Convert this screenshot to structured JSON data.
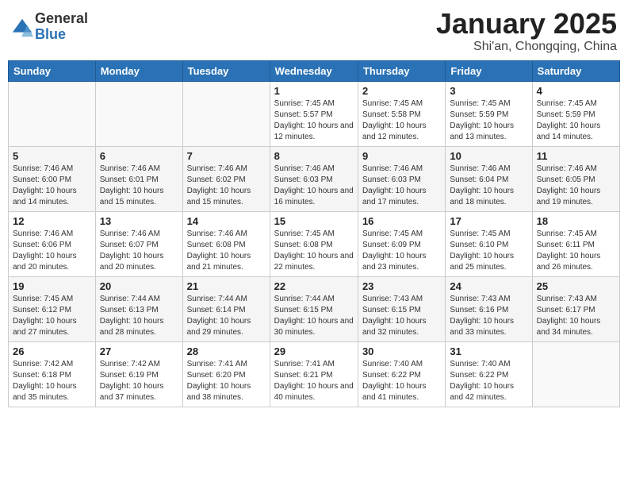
{
  "header": {
    "logo": {
      "general": "General",
      "blue": "Blue"
    },
    "title": "January 2025",
    "location": "Shi'an, Chongqing, China"
  },
  "calendar": {
    "weekdays": [
      "Sunday",
      "Monday",
      "Tuesday",
      "Wednesday",
      "Thursday",
      "Friday",
      "Saturday"
    ],
    "weeks": [
      [
        {
          "day": "",
          "info": ""
        },
        {
          "day": "",
          "info": ""
        },
        {
          "day": "",
          "info": ""
        },
        {
          "day": "1",
          "info": "Sunrise: 7:45 AM\nSunset: 5:57 PM\nDaylight: 10 hours and 12 minutes."
        },
        {
          "day": "2",
          "info": "Sunrise: 7:45 AM\nSunset: 5:58 PM\nDaylight: 10 hours and 12 minutes."
        },
        {
          "day": "3",
          "info": "Sunrise: 7:45 AM\nSunset: 5:59 PM\nDaylight: 10 hours and 13 minutes."
        },
        {
          "day": "4",
          "info": "Sunrise: 7:45 AM\nSunset: 5:59 PM\nDaylight: 10 hours and 14 minutes."
        }
      ],
      [
        {
          "day": "5",
          "info": "Sunrise: 7:46 AM\nSunset: 6:00 PM\nDaylight: 10 hours and 14 minutes."
        },
        {
          "day": "6",
          "info": "Sunrise: 7:46 AM\nSunset: 6:01 PM\nDaylight: 10 hours and 15 minutes."
        },
        {
          "day": "7",
          "info": "Sunrise: 7:46 AM\nSunset: 6:02 PM\nDaylight: 10 hours and 15 minutes."
        },
        {
          "day": "8",
          "info": "Sunrise: 7:46 AM\nSunset: 6:03 PM\nDaylight: 10 hours and 16 minutes."
        },
        {
          "day": "9",
          "info": "Sunrise: 7:46 AM\nSunset: 6:03 PM\nDaylight: 10 hours and 17 minutes."
        },
        {
          "day": "10",
          "info": "Sunrise: 7:46 AM\nSunset: 6:04 PM\nDaylight: 10 hours and 18 minutes."
        },
        {
          "day": "11",
          "info": "Sunrise: 7:46 AM\nSunset: 6:05 PM\nDaylight: 10 hours and 19 minutes."
        }
      ],
      [
        {
          "day": "12",
          "info": "Sunrise: 7:46 AM\nSunset: 6:06 PM\nDaylight: 10 hours and 20 minutes."
        },
        {
          "day": "13",
          "info": "Sunrise: 7:46 AM\nSunset: 6:07 PM\nDaylight: 10 hours and 20 minutes."
        },
        {
          "day": "14",
          "info": "Sunrise: 7:46 AM\nSunset: 6:08 PM\nDaylight: 10 hours and 21 minutes."
        },
        {
          "day": "15",
          "info": "Sunrise: 7:45 AM\nSunset: 6:08 PM\nDaylight: 10 hours and 22 minutes."
        },
        {
          "day": "16",
          "info": "Sunrise: 7:45 AM\nSunset: 6:09 PM\nDaylight: 10 hours and 23 minutes."
        },
        {
          "day": "17",
          "info": "Sunrise: 7:45 AM\nSunset: 6:10 PM\nDaylight: 10 hours and 25 minutes."
        },
        {
          "day": "18",
          "info": "Sunrise: 7:45 AM\nSunset: 6:11 PM\nDaylight: 10 hours and 26 minutes."
        }
      ],
      [
        {
          "day": "19",
          "info": "Sunrise: 7:45 AM\nSunset: 6:12 PM\nDaylight: 10 hours and 27 minutes."
        },
        {
          "day": "20",
          "info": "Sunrise: 7:44 AM\nSunset: 6:13 PM\nDaylight: 10 hours and 28 minutes."
        },
        {
          "day": "21",
          "info": "Sunrise: 7:44 AM\nSunset: 6:14 PM\nDaylight: 10 hours and 29 minutes."
        },
        {
          "day": "22",
          "info": "Sunrise: 7:44 AM\nSunset: 6:15 PM\nDaylight: 10 hours and 30 minutes."
        },
        {
          "day": "23",
          "info": "Sunrise: 7:43 AM\nSunset: 6:15 PM\nDaylight: 10 hours and 32 minutes."
        },
        {
          "day": "24",
          "info": "Sunrise: 7:43 AM\nSunset: 6:16 PM\nDaylight: 10 hours and 33 minutes."
        },
        {
          "day": "25",
          "info": "Sunrise: 7:43 AM\nSunset: 6:17 PM\nDaylight: 10 hours and 34 minutes."
        }
      ],
      [
        {
          "day": "26",
          "info": "Sunrise: 7:42 AM\nSunset: 6:18 PM\nDaylight: 10 hours and 35 minutes."
        },
        {
          "day": "27",
          "info": "Sunrise: 7:42 AM\nSunset: 6:19 PM\nDaylight: 10 hours and 37 minutes."
        },
        {
          "day": "28",
          "info": "Sunrise: 7:41 AM\nSunset: 6:20 PM\nDaylight: 10 hours and 38 minutes."
        },
        {
          "day": "29",
          "info": "Sunrise: 7:41 AM\nSunset: 6:21 PM\nDaylight: 10 hours and 40 minutes."
        },
        {
          "day": "30",
          "info": "Sunrise: 7:40 AM\nSunset: 6:22 PM\nDaylight: 10 hours and 41 minutes."
        },
        {
          "day": "31",
          "info": "Sunrise: 7:40 AM\nSunset: 6:22 PM\nDaylight: 10 hours and 42 minutes."
        },
        {
          "day": "",
          "info": ""
        }
      ]
    ]
  }
}
